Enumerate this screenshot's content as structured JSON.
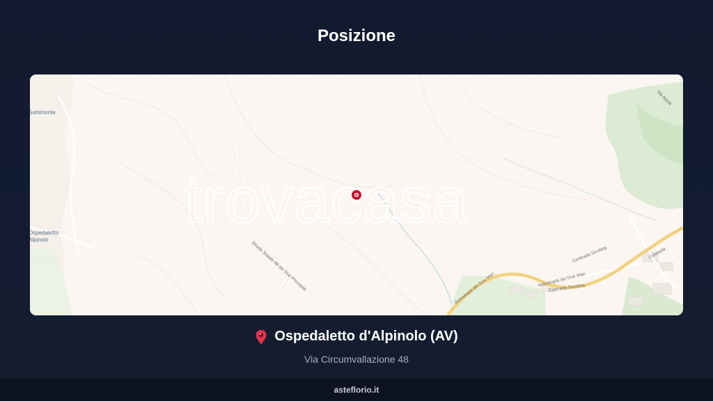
{
  "header": {
    "title": "Posizione"
  },
  "map": {
    "watermark": "trovacasa",
    "places": {
      "summonte": "Summonte",
      "ospedaletto_line1": "Ospedaletto",
      "ospedaletto_line2": "Alpinolo"
    },
    "roads": {
      "statale_88": "Strada Statale 88 dei Due Principati",
      "autostrada_1": "Autostrada dei Due Mari",
      "autostrada_2": "Autostrada dei Due Mari",
      "contrada_scrofeta_1": "Contrada Scrofeta",
      "contrada_scrofeta_2": "Contrada Scrofeta",
      "contrada_right": "Contrada",
      "via_appia": "Via Appia"
    },
    "marker_icon": "map-marker-icon",
    "colors": {
      "background": "#fbf6f1",
      "forest": "#d7ead0",
      "motorway": "#f6d98d",
      "marker": "#c8102e"
    }
  },
  "location": {
    "pin_icon": "pin-icon",
    "name": "Ospedaletto d'Alpinolo (AV)",
    "address": "Via Circumvallazione 48"
  },
  "footer": {
    "site": "asteflorio.it"
  }
}
